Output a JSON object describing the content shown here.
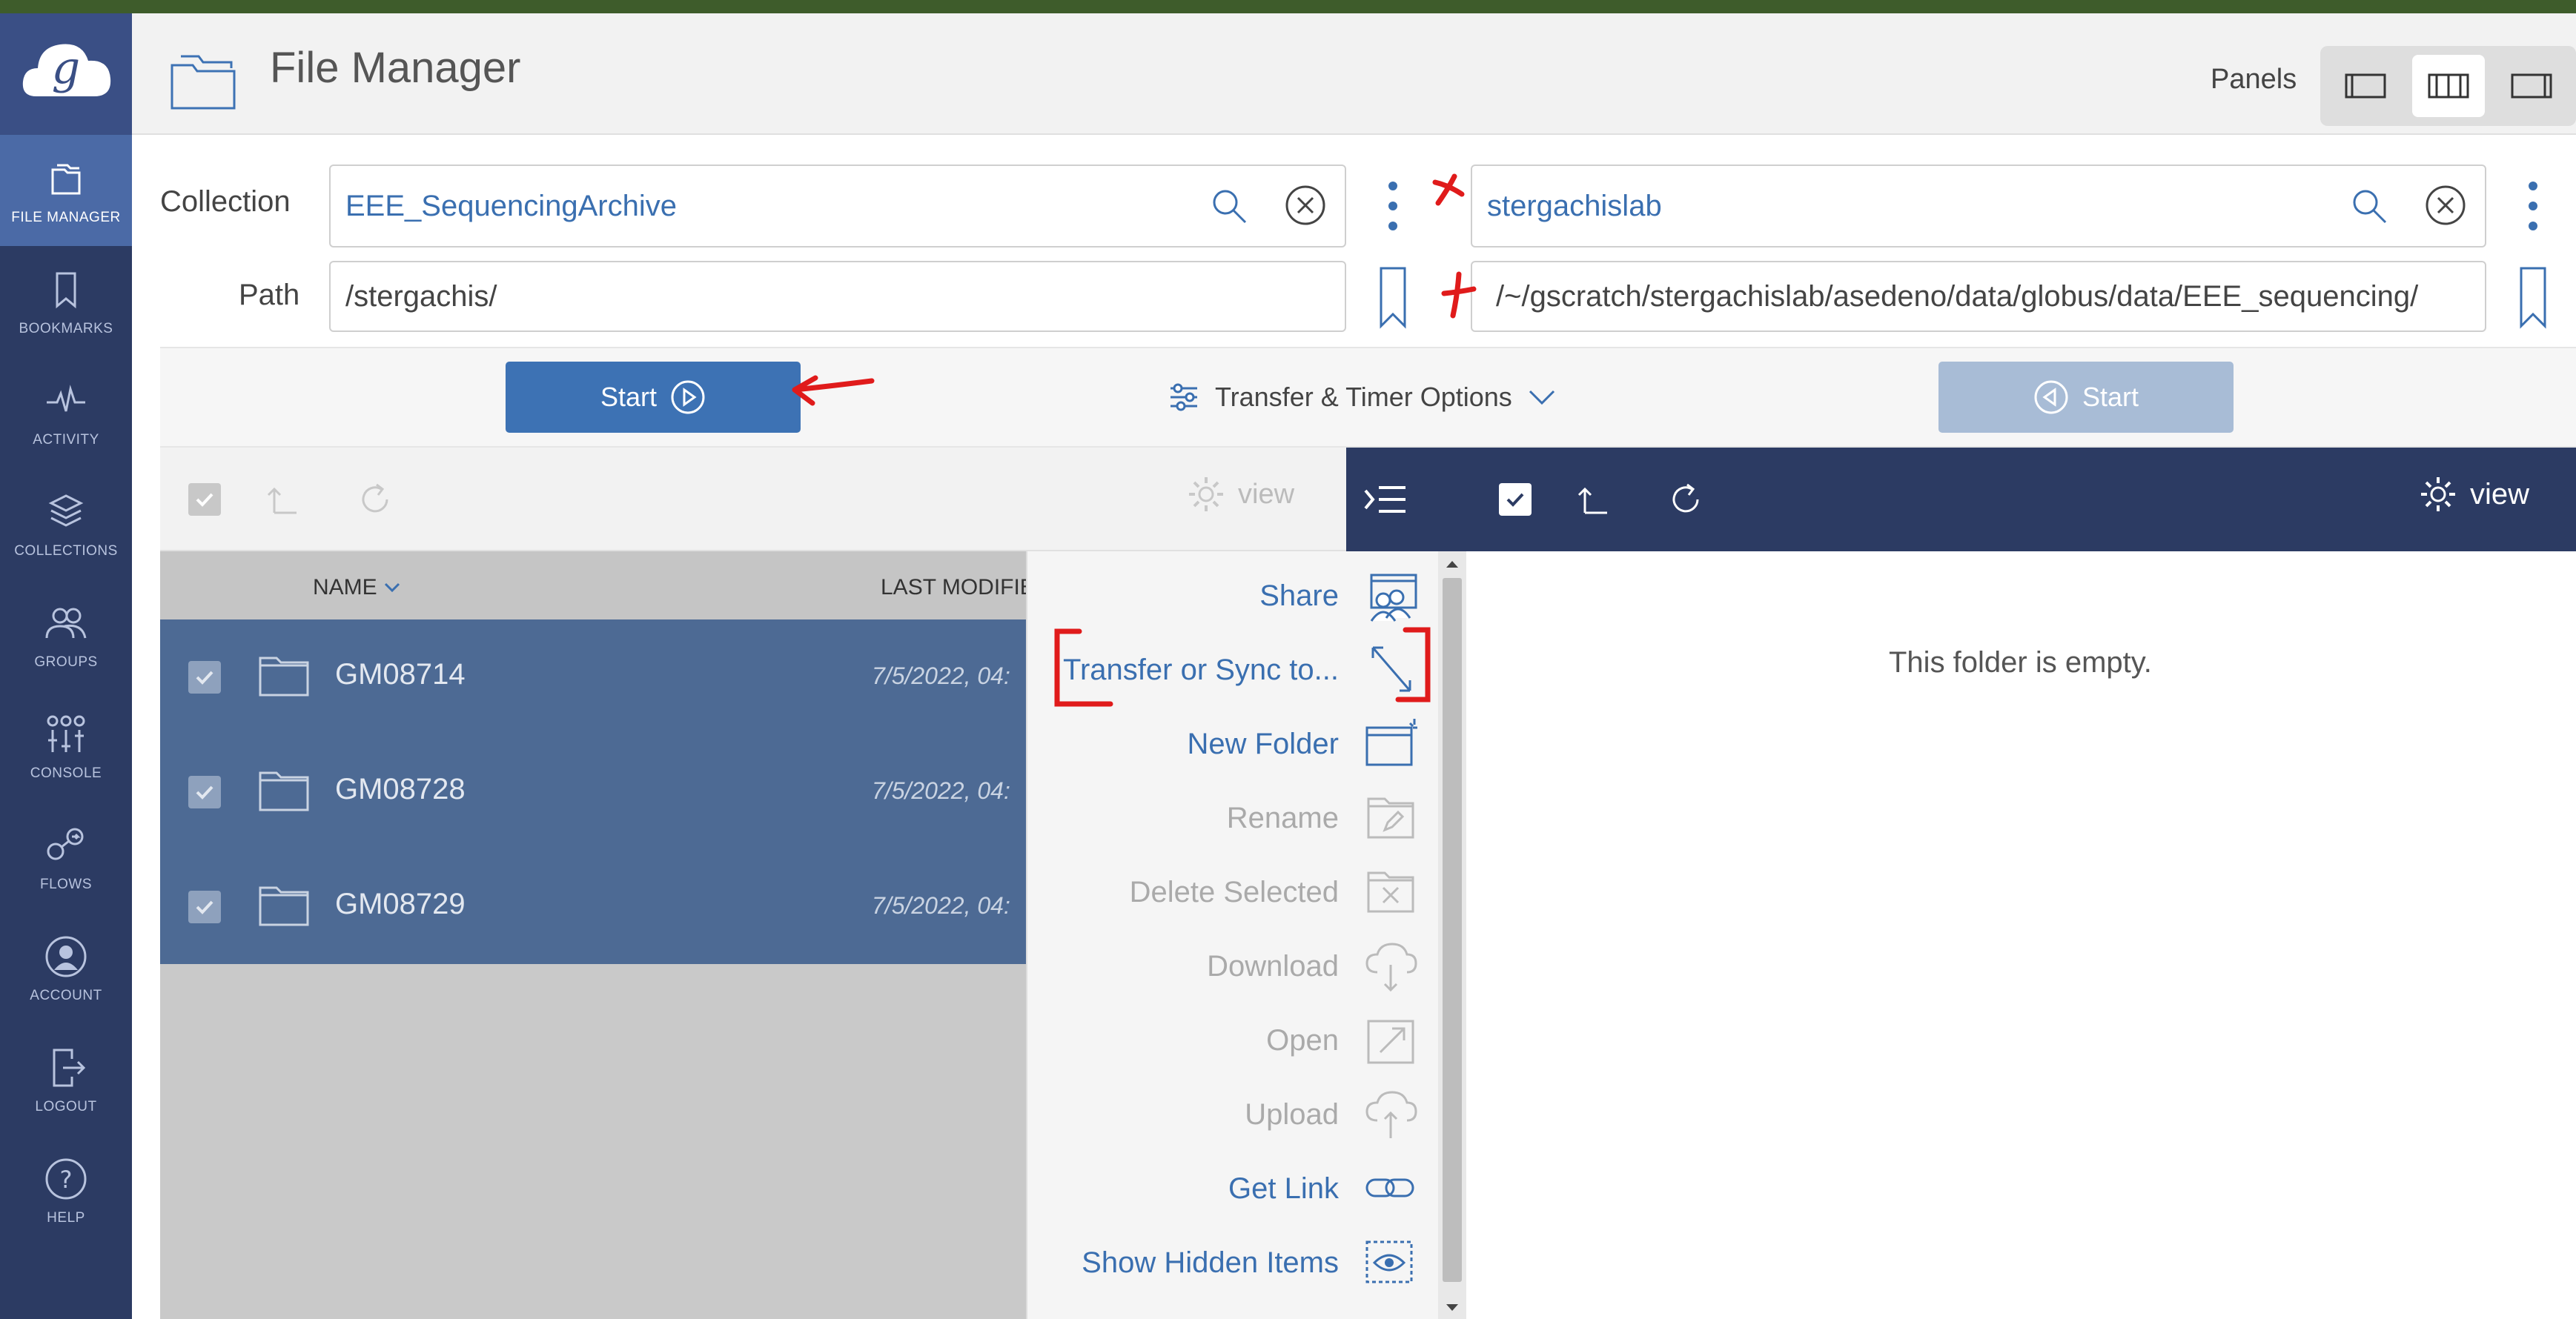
{
  "header": {
    "title": "File Manager",
    "panels_label": "Panels"
  },
  "nav": {
    "items": [
      {
        "label": "FILE MANAGER",
        "icon": "file-manager-icon"
      },
      {
        "label": "BOOKMARKS",
        "icon": "bookmark-icon"
      },
      {
        "label": "ACTIVITY",
        "icon": "activity-icon"
      },
      {
        "label": "COLLECTIONS",
        "icon": "collections-icon"
      },
      {
        "label": "GROUPS",
        "icon": "groups-icon"
      },
      {
        "label": "CONSOLE",
        "icon": "console-icon"
      },
      {
        "label": "FLOWS",
        "icon": "flows-icon"
      },
      {
        "label": "ACCOUNT",
        "icon": "account-icon"
      },
      {
        "label": "LOGOUT",
        "icon": "logout-icon"
      },
      {
        "label": "HELP",
        "icon": "help-icon"
      }
    ]
  },
  "left": {
    "collection_label": "Collection",
    "collection_value": "EEE_SequencingArchive",
    "path_label": "Path",
    "path_value": "/stergachis/",
    "start_label": "Start",
    "view_label": "view",
    "columns": {
      "name": "NAME",
      "modified": "LAST MODIFIE"
    },
    "rows": [
      {
        "name": "GM08714",
        "modified": "7/5/2022, 04:"
      },
      {
        "name": "GM08728",
        "modified": "7/5/2022, 04:"
      },
      {
        "name": "GM08729",
        "modified": "7/5/2022, 04:"
      }
    ]
  },
  "right": {
    "collection_value": "stergachislab",
    "path_value": "/~/gscratch/stergachislab/asedeno/data/globus/data/EEE_sequencing/",
    "start_label": "Start",
    "view_label": "view",
    "empty_message": "This folder is empty."
  },
  "transfer_options_label": "Transfer & Timer Options",
  "context_menu": {
    "items": [
      {
        "label": "Share",
        "enabled": true
      },
      {
        "label": "Transfer or Sync to...",
        "enabled": true
      },
      {
        "label": "New Folder",
        "enabled": true
      },
      {
        "label": "Rename",
        "enabled": false
      },
      {
        "label": "Delete Selected",
        "enabled": false
      },
      {
        "label": "Download",
        "enabled": false
      },
      {
        "label": "Open",
        "enabled": false
      },
      {
        "label": "Upload",
        "enabled": false
      },
      {
        "label": "Get Link",
        "enabled": true
      },
      {
        "label": "Show Hidden Items",
        "enabled": true
      }
    ]
  },
  "colors": {
    "nav_bg": "#2c3b63",
    "nav_active": "#4b6aa6",
    "accent": "#3d72b4",
    "selected_row": "#4d6a94",
    "annotation_red": "#e01b1b"
  }
}
